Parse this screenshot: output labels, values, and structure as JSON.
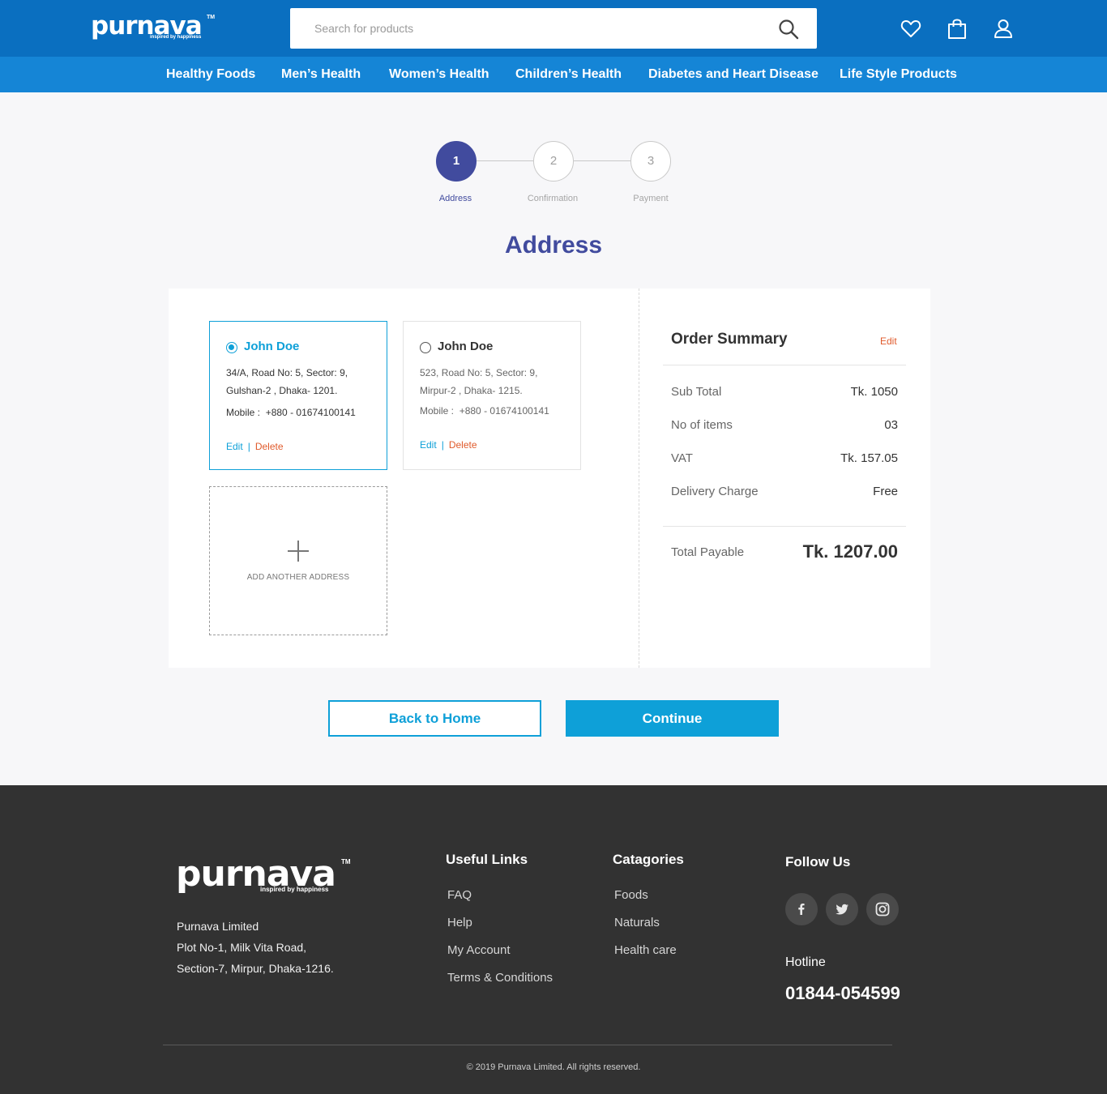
{
  "header": {
    "logo": {
      "word": "purnava",
      "tm": "TM",
      "tagline": "inspired by happiness"
    },
    "search": {
      "placeholder": "Search for products"
    },
    "icons": [
      "heart-icon",
      "shopping-bag-icon",
      "user-icon"
    ]
  },
  "nav": {
    "items": [
      "Healthy Foods",
      "Men’s Health",
      "Women’s Health",
      "Children’s Health",
      "Diabetes and Heart Disease",
      "Life Style Products"
    ]
  },
  "stepper": {
    "steps": [
      {
        "number": "1",
        "label": "Address",
        "active": true
      },
      {
        "number": "2",
        "label": "Confirmation",
        "active": false
      },
      {
        "number": "3",
        "label": "Payment",
        "active": false
      }
    ]
  },
  "page": {
    "title": "Address"
  },
  "addresses": [
    {
      "name": "John Doe",
      "selected": true,
      "line1": "34/A, Road No: 5, Sector: 9,",
      "line2": "Gulshan-2 , Dhaka- 1201.",
      "mobile_label": "Mobile :",
      "mobile": "+880 - 01674100141",
      "edit": "Edit",
      "separator": "|",
      "delete": "Delete"
    },
    {
      "name": "John Doe",
      "selected": false,
      "line1": "523, Road No: 5, Sector: 9,",
      "line2": "Mirpur-2 , Dhaka- 1215.",
      "mobile_label": "Mobile :",
      "mobile": "+880 - 01674100141",
      "edit": "Edit",
      "separator": "|",
      "delete": "Delete"
    }
  ],
  "add_address": {
    "label": "ADD ANOTHER ADDRESS"
  },
  "summary": {
    "title": "Order Summary",
    "edit": "Edit",
    "rows": [
      {
        "label": "Sub Total",
        "value": "Tk. 1050"
      },
      {
        "label": "No of items",
        "value": "03"
      },
      {
        "label": "VAT",
        "value": "Tk. 157.05"
      },
      {
        "label": "Delivery Charge",
        "value": "Free"
      }
    ],
    "total_label": "Total Payable",
    "total_value": "Tk. 1207.00"
  },
  "buttons": {
    "back": "Back to Home",
    "continue": "Continue"
  },
  "footer": {
    "logo": {
      "word": "purnava",
      "tm": "TM",
      "tagline": "inspired by happiness"
    },
    "address": [
      "Purnava Limited",
      "Plot No-1, Milk Vita Road,",
      "Section-7,  Mirpur, Dhaka-1216."
    ],
    "useful_links": {
      "title": "Useful Links",
      "items": [
        "FAQ",
        "Help",
        "My Account",
        "Terms & Conditions"
      ]
    },
    "categories": {
      "title": "Catagories",
      "items": [
        "Foods",
        "Naturals",
        "Health care"
      ]
    },
    "follow": {
      "title": "Follow Us",
      "icons": [
        "facebook-icon",
        "twitter-icon",
        "instagram-icon"
      ]
    },
    "hotline_label": "Hotline",
    "hotline": "01844-054599",
    "copyright": "© 2019 Purnava Limited. All rights reserved."
  },
  "colors": {
    "header_bg": "#0a6fc0",
    "nav_bg": "#1585d6",
    "primary": "#0ea0d8",
    "title_purple": "#414b9e",
    "danger": "#e05a2b",
    "footer_bg": "#323232"
  }
}
